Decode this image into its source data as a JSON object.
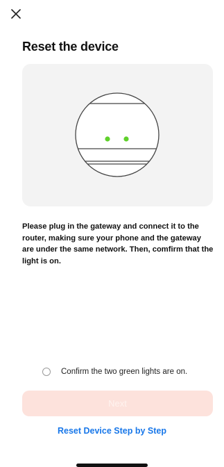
{
  "header": {
    "close_icon": "close-icon"
  },
  "page": {
    "title": "Reset the device"
  },
  "illustration": {
    "device_icon": "gateway-device-illustration",
    "light_color": "#5fd12b",
    "card_color": "#f3f3f3"
  },
  "instructions": {
    "text": "Please plug in the gateway and connect it to the router, making sure your phone and the gateway are under the same network. Then, comfirm that the light is on."
  },
  "confirm": {
    "label": "Confirm the two green lights are on.",
    "checked": false
  },
  "actions": {
    "next_label": "Next",
    "next_enabled": false,
    "next_color": "#fde2dc",
    "step_link_label": "Reset Device Step by Step",
    "link_color": "#1877e9"
  }
}
